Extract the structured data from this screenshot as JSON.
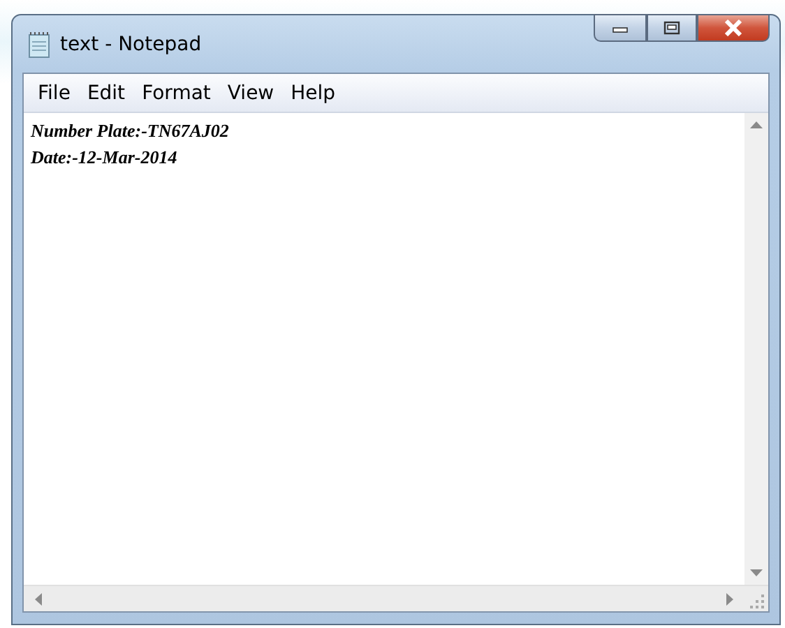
{
  "window": {
    "title": "text - Notepad"
  },
  "menu": [
    "File",
    "Edit",
    "Format",
    "View",
    "Help"
  ],
  "document": {
    "lines": [
      "Number Plate:-TN67AJ02",
      "Date:-12-Mar-2014"
    ]
  }
}
